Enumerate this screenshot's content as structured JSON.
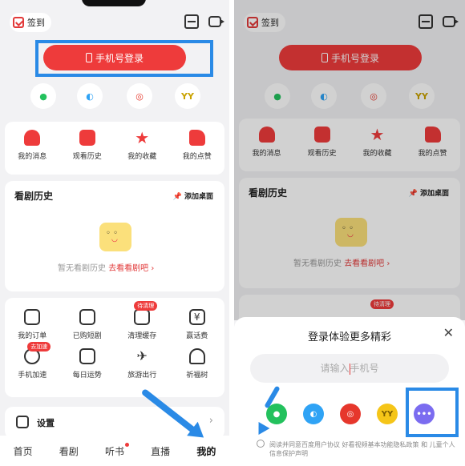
{
  "left": {
    "checkin": "签到",
    "login_button": "手机号登录",
    "social": [
      "WeChat",
      "QQ",
      "Weibo",
      "YY"
    ],
    "quick": [
      "我的消息",
      "观看历史",
      "我的收藏",
      "我的点赞"
    ],
    "history": {
      "title": "看剧历史",
      "add_desktop": "添加桌面",
      "empty_text": "暂无看剧历史",
      "empty_link": "去看看剧吧 ›"
    },
    "tools": [
      {
        "label": "我的订单",
        "icon": "order-icon"
      },
      {
        "label": "已购短剧",
        "icon": "purchased-icon"
      },
      {
        "label": "清理缓存",
        "icon": "clean-icon",
        "badge": "待清理"
      },
      {
        "label": "赢话费",
        "icon": "yen-icon"
      },
      {
        "label": "手机加速",
        "icon": "rocket-icon",
        "badge": "去加速"
      },
      {
        "label": "每日运势",
        "icon": "fortune-icon"
      },
      {
        "label": "旅游出行",
        "icon": "plane-icon"
      },
      {
        "label": "祈福树",
        "icon": "tree-icon"
      }
    ],
    "settings": "设置",
    "tabs": [
      "首页",
      "看剧",
      "听书",
      "直播",
      "我的"
    ]
  },
  "right": {
    "checkin": "签到",
    "login_button": "手机号登录",
    "quick": [
      "我的消息",
      "观看历史",
      "我的收藏",
      "我的点赞"
    ],
    "history": {
      "title": "看剧历史",
      "add_desktop": "添加桌面",
      "empty_text": "暂无看剧历史",
      "empty_link": "去看看剧吧 ›"
    },
    "badge": "待清理",
    "sheet": {
      "title": "登录体验更多精彩",
      "close": "✕",
      "input_placeholder_a": "请输入",
      "input_placeholder_b": "手机号",
      "agreement": "阅读并同意百度用户协议 好看视频基本功能隐私政策 和 儿童个人信息保护声明"
    }
  },
  "colors": {
    "accent": "#ee3b3b",
    "annotation": "#2a8ae6",
    "wechat": "#23c15d",
    "qq": "#2fa3f5",
    "weibo": "#e6372c",
    "yy": "#f5c518",
    "more": "#7b6cf0"
  }
}
